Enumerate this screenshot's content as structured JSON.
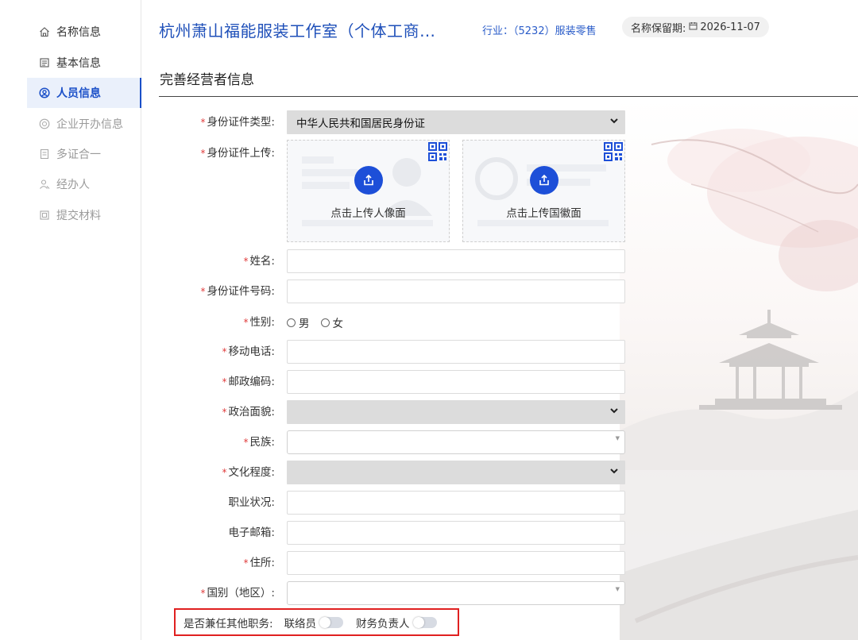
{
  "sidebar": {
    "items": [
      {
        "label": "名称信息",
        "icon": "home-icon",
        "state": "normal"
      },
      {
        "label": "基本信息",
        "icon": "document-icon",
        "state": "normal"
      },
      {
        "label": "人员信息",
        "icon": "user-circle-icon",
        "state": "active"
      },
      {
        "label": "企业开办信息",
        "icon": "badge-icon",
        "state": "disabled"
      },
      {
        "label": "多证合一",
        "icon": "certificate-icon",
        "state": "disabled"
      },
      {
        "label": "经办人",
        "icon": "person-icon",
        "state": "disabled"
      },
      {
        "label": "提交材料",
        "icon": "file-icon",
        "state": "disabled"
      }
    ]
  },
  "header": {
    "company": "杭州萧山福能服装工作室（个体工商…",
    "industry_label": "行业：",
    "industry_value": "（5232）服装零售",
    "reserve_label": "名称保留期:",
    "reserve_date": "2026-11-07"
  },
  "section_title": "完善经营者信息",
  "form": {
    "id_type": {
      "label": "身份证件类型:",
      "value": "中华人民共和国居民身份证"
    },
    "id_upload": {
      "label": "身份证件上传:",
      "front_caption": "点击上传人像面",
      "back_caption": "点击上传国徽面"
    },
    "name": {
      "label": "姓名:"
    },
    "id_number": {
      "label": "身份证件号码:"
    },
    "gender": {
      "label": "性别:",
      "options": [
        "男",
        "女"
      ]
    },
    "mobile": {
      "label": "移动电话:"
    },
    "postcode": {
      "label": "邮政编码:"
    },
    "political": {
      "label": "政治面貌:"
    },
    "ethnicity": {
      "label": "民族:"
    },
    "education": {
      "label": "文化程度:"
    },
    "occupation": {
      "label": "职业状况:"
    },
    "email": {
      "label": "电子邮箱:"
    },
    "address": {
      "label": "住所:"
    },
    "nationality": {
      "label": "国别（地区）:"
    }
  },
  "duties": {
    "label": "是否兼任其他职务:",
    "liaison": "联络员",
    "finance": "财务负责人"
  },
  "colors": {
    "accent": "#1d4fd8",
    "required": "#e03b3b",
    "highlight_border": "#e02020"
  }
}
